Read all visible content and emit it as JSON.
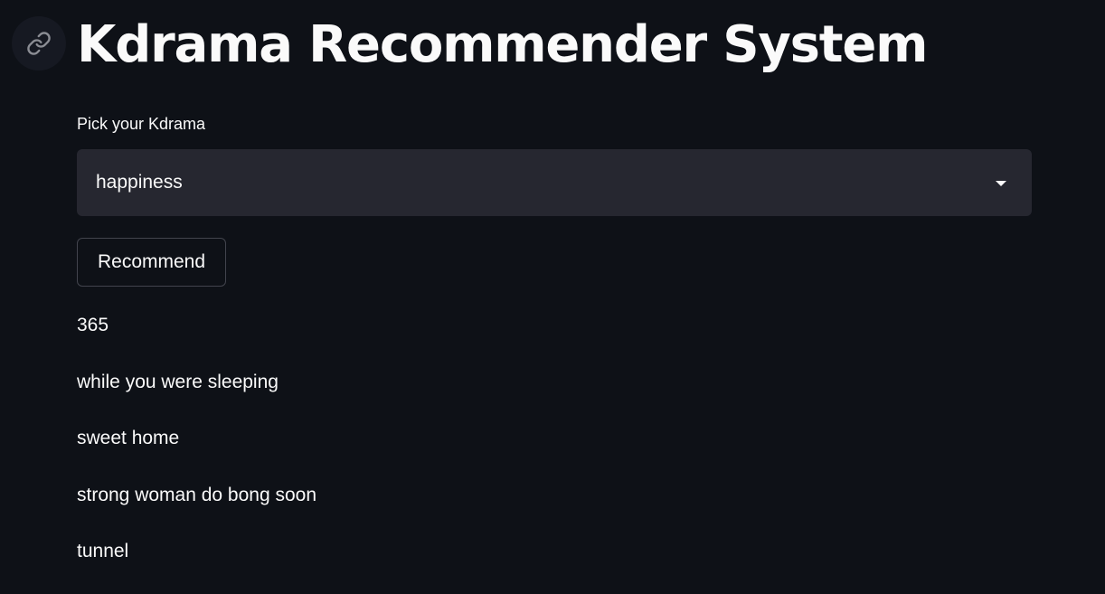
{
  "header": {
    "anchor_icon": "link-icon",
    "title": "Kdrama Recommender System"
  },
  "picker": {
    "label": "Pick your Kdrama",
    "selected": "happiness",
    "caret_icon": "caret-down-icon"
  },
  "actions": {
    "recommend_label": "Recommend"
  },
  "recommendations": [
    "365",
    "while you were sleeping",
    "sweet home",
    "strong woman do bong soon",
    "tunnel"
  ],
  "colors": {
    "background": "#0e1117",
    "select_background": "#262730",
    "text": "#fafafa",
    "button_border": "#42444d"
  }
}
